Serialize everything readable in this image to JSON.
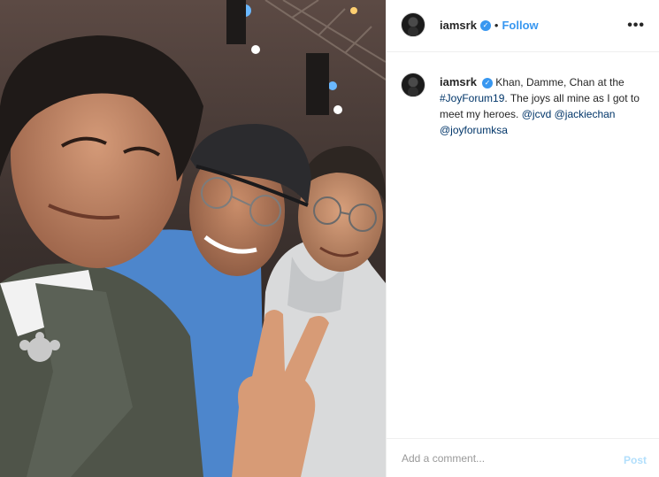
{
  "post": {
    "username": "iamsrk",
    "separator": "•",
    "follow_label": "Follow",
    "more_label": "•••",
    "verified_icon": "verified-badge-icon"
  },
  "caption": {
    "username": "iamsrk",
    "text_1": "Khan, Damme, Chan at the",
    "hashtag": "#JoyForum19",
    "text_2": ". The joys all mine as I got to meet my heroes.",
    "mention_1": "@jcvd",
    "mention_2": "@jackiechan",
    "mention_3": "@joyforumksa"
  },
  "comment": {
    "placeholder": "Add a comment...",
    "post_label": "Post"
  },
  "colors": {
    "link": "#003569",
    "accent": "#3897f0",
    "post_disabled": "#b2dffc"
  }
}
